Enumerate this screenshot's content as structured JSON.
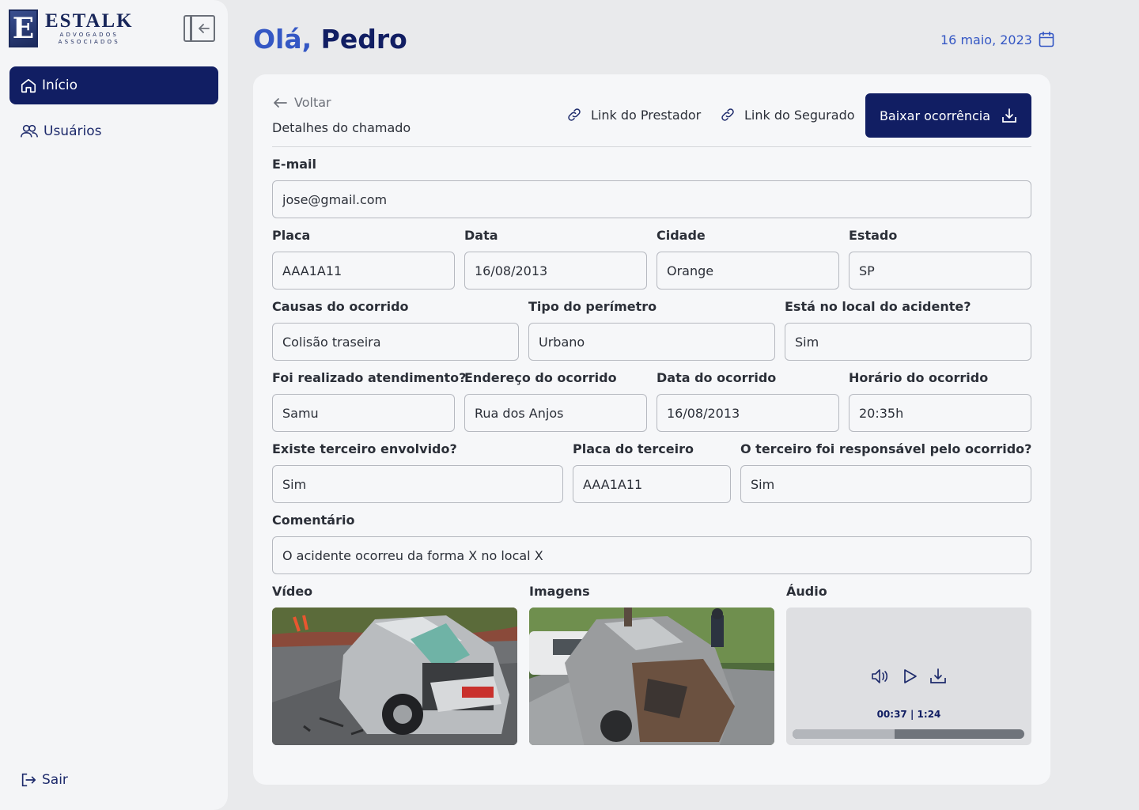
{
  "brand": {
    "logo_letter": "E",
    "name": "ESTALK",
    "sub1": "ADVOGADOS",
    "sub2": "ASSOCIADOS"
  },
  "sidebar": {
    "items": [
      {
        "label": "Início",
        "icon": "home-icon",
        "active": true
      },
      {
        "label": "Usuários",
        "icon": "users-icon",
        "active": false
      }
    ],
    "logout_label": "Sair"
  },
  "header": {
    "greeting_hi": "Olá,",
    "greeting_name": "Pedro",
    "date": "16 maio, 2023"
  },
  "card": {
    "back_label": "Voltar",
    "title": "Detalhes do chamado",
    "link_prestador": "Link do Prestador",
    "link_segurado": "Link do Segurado",
    "download_label": "Baixar ocorrência"
  },
  "fields": {
    "email": {
      "label": "E-mail",
      "value": "jose@gmail.com"
    },
    "placa": {
      "label": "Placa",
      "value": "AAA1A11"
    },
    "data": {
      "label": "Data",
      "value": "16/08/2013"
    },
    "cidade": {
      "label": "Cidade",
      "value": "Orange"
    },
    "estado": {
      "label": "Estado",
      "value": "SP"
    },
    "causas": {
      "label": "Causas do ocorrido",
      "value": "Colisão traseira"
    },
    "perimetro": {
      "label": "Tipo do perímetro",
      "value": "Urbano"
    },
    "local": {
      "label": "Está no local do acidente?",
      "value": "Sim"
    },
    "atendimento": {
      "label": "Foi realizado atendimento?",
      "value": "Samu"
    },
    "endereco": {
      "label": "Endereço do ocorrido",
      "value": "Rua dos Anjos"
    },
    "data_ocorrido": {
      "label": "Data do ocorrido",
      "value": "16/08/2013"
    },
    "horario": {
      "label": "Horário do ocorrido",
      "value": "20:35h"
    },
    "terceiro": {
      "label": "Existe terceiro envolvido?",
      "value": "Sim"
    },
    "placa_terceiro": {
      "label": "Placa do terceiro",
      "value": "AAA1A11"
    },
    "responsavel": {
      "label": "O terceiro foi responsável pelo ocorrido?",
      "value": "Sim"
    },
    "comentario": {
      "label": "Comentário",
      "value": "O acidente ocorreu da forma X no local X"
    }
  },
  "media": {
    "video_label": "Vídeo",
    "images_label": "Imagens",
    "audio_label": "Áudio",
    "audio_current": "00:37",
    "audio_total": "1:24",
    "audio_progress": 0.44
  },
  "colors": {
    "primary": "#111e63",
    "accent": "#3457c4"
  }
}
